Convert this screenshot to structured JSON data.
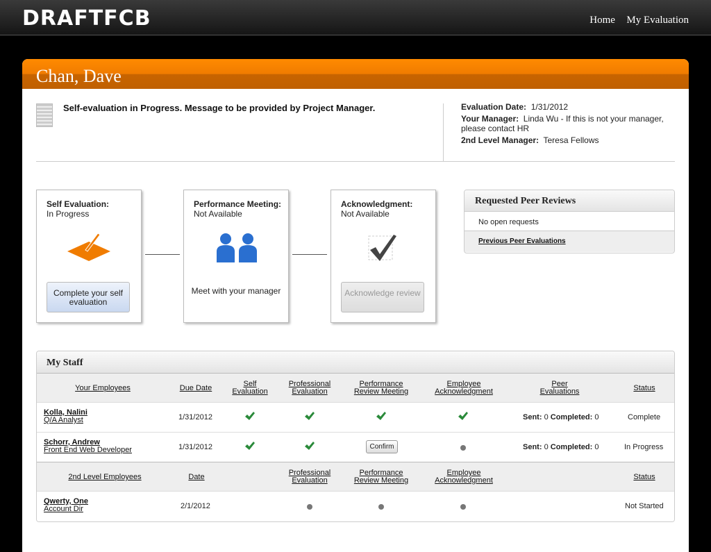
{
  "brand": {
    "logo": "DRAFTFCB"
  },
  "nav": {
    "home": "Home",
    "my_evaluation": "My Evaluation"
  },
  "employee": {
    "name": "Chan, Dave"
  },
  "message": "Self-evaluation in Progress. Message to be provided by Project Manager.",
  "evaluation": {
    "date_label": "Evaluation Date:",
    "date_value": "1/31/2012",
    "manager_label": "Your Manager:",
    "manager_value": "Linda Wu - If this is not your manager, please contact HR",
    "second_manager_label": "2nd Level Manager:",
    "second_manager_value": "Teresa Fellows"
  },
  "steps": {
    "self": {
      "title": "Self Evaluation:",
      "status": "In Progress",
      "button": "Complete your self evaluation"
    },
    "meeting": {
      "title": "Performance Meeting:",
      "status": "Not Available",
      "text": "Meet with your manager"
    },
    "ack": {
      "title": "Acknowledgment:",
      "status": "Not Available",
      "button": "Acknowledge review"
    }
  },
  "peer_reviews": {
    "title": "Requested Peer Reviews",
    "empty": "No open requests",
    "previous_link": "Previous Peer Evaluations"
  },
  "staff": {
    "title": "My Staff",
    "headers": {
      "employees": "Your Employees",
      "due_date": "Due Date",
      "self_eval": "Self Evaluation",
      "prof_eval": "Professional Evaluation",
      "perf_meeting": "Performance Review Meeting",
      "emp_ack": "Employee Acknowledgment",
      "peer_evals": "Peer Evaluations",
      "status": "Status"
    },
    "employees": [
      {
        "name": "Kolla, Nalini",
        "role": "Q/A Analyst",
        "due": "1/31/2012",
        "sent_label": "Sent:",
        "sent": "0",
        "completed_label": "Completed:",
        "completed": "0",
        "status": "Complete"
      },
      {
        "name": "Schorr, Andrew",
        "role": "Front End Web Developer",
        "due": "1/31/2012",
        "confirm": "Confirm",
        "sent_label": "Sent:",
        "sent": "0",
        "completed_label": "Completed:",
        "completed": "0",
        "status": "In Progress"
      }
    ],
    "second_headers": {
      "employees": "2nd Level Employees",
      "date": "Date",
      "prof_eval": "Professional Evaluation",
      "perf_meeting": "Performance Review Meeting",
      "emp_ack": "Employee Acknowledgment",
      "status": "Status"
    },
    "second_employees": [
      {
        "name": "Qwerty, One",
        "role": "Account Dir",
        "date": "2/1/2012",
        "status": "Not Started"
      }
    ]
  },
  "colors": {
    "accent": "#f07c00",
    "check": "#2a8a3a",
    "button_blue": "#c9d8f0"
  }
}
